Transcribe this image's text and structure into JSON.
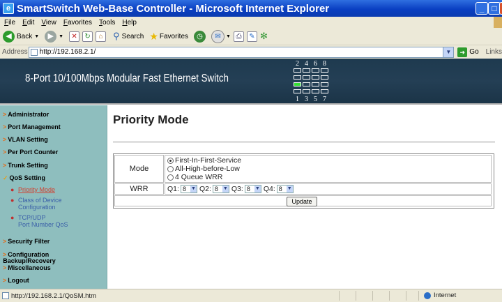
{
  "window": {
    "title": "SmartSwitch Web-Base Controller - Microsoft Internet Explorer",
    "min_glyph": "_",
    "max_glyph": "□",
    "close_glyph": "×"
  },
  "menu": [
    "File",
    "Edit",
    "View",
    "Favorites",
    "Tools",
    "Help"
  ],
  "toolbar": {
    "back_label": "Back",
    "search_label": "Search",
    "favorites_label": "Favorites"
  },
  "address": {
    "label": "Address",
    "url": "http://192.168.2.1/",
    "go_label": "Go",
    "links_label": "Links"
  },
  "banner": {
    "title": "8-Port 10/100Mbps Modular Fast Ethernet Switch",
    "top_ports": [
      "2",
      "4",
      "6",
      "8"
    ],
    "bottom_ports": [
      "1",
      "3",
      "5",
      "7"
    ],
    "active_port": "1",
    "active_color": "#33dd33"
  },
  "sidebar": {
    "items": [
      {
        "label": "Administrator"
      },
      {
        "label": "Port Management"
      },
      {
        "label": "VLAN Setting"
      },
      {
        "label": "Per Port Counter"
      },
      {
        "label": "Trunk Setting"
      },
      {
        "label": "QoS Setting"
      }
    ],
    "qos_subitems": [
      {
        "label": "Priority Mode"
      },
      {
        "label": "Class of Device",
        "label2": "Configuration"
      },
      {
        "label": "TCP/UDP",
        "label2": "Port Number QoS"
      }
    ],
    "items_after": [
      {
        "label": "Security Filter"
      },
      {
        "label": "Configuration",
        "label2": "Backup/Recovery",
        "label3": "Miscellaneous"
      },
      {
        "label": "Logout"
      }
    ]
  },
  "main": {
    "title": "Priority Mode",
    "mode_label": "Mode",
    "mode_options": [
      "First-In-First-Service",
      "All-High-before-Low",
      "4 Queue WRR"
    ],
    "mode_selected": "First-In-First-Service",
    "wrr_label": "WRR",
    "queues": [
      {
        "label": "Q1:",
        "value": "8"
      },
      {
        "label": "Q2:",
        "value": "8"
      },
      {
        "label": "Q3:",
        "value": "8"
      },
      {
        "label": "Q4:",
        "value": "8"
      }
    ],
    "update_label": "Update"
  },
  "status": {
    "url": "http://192.168.2.1/QoSM.htm",
    "zone": "Internet"
  }
}
